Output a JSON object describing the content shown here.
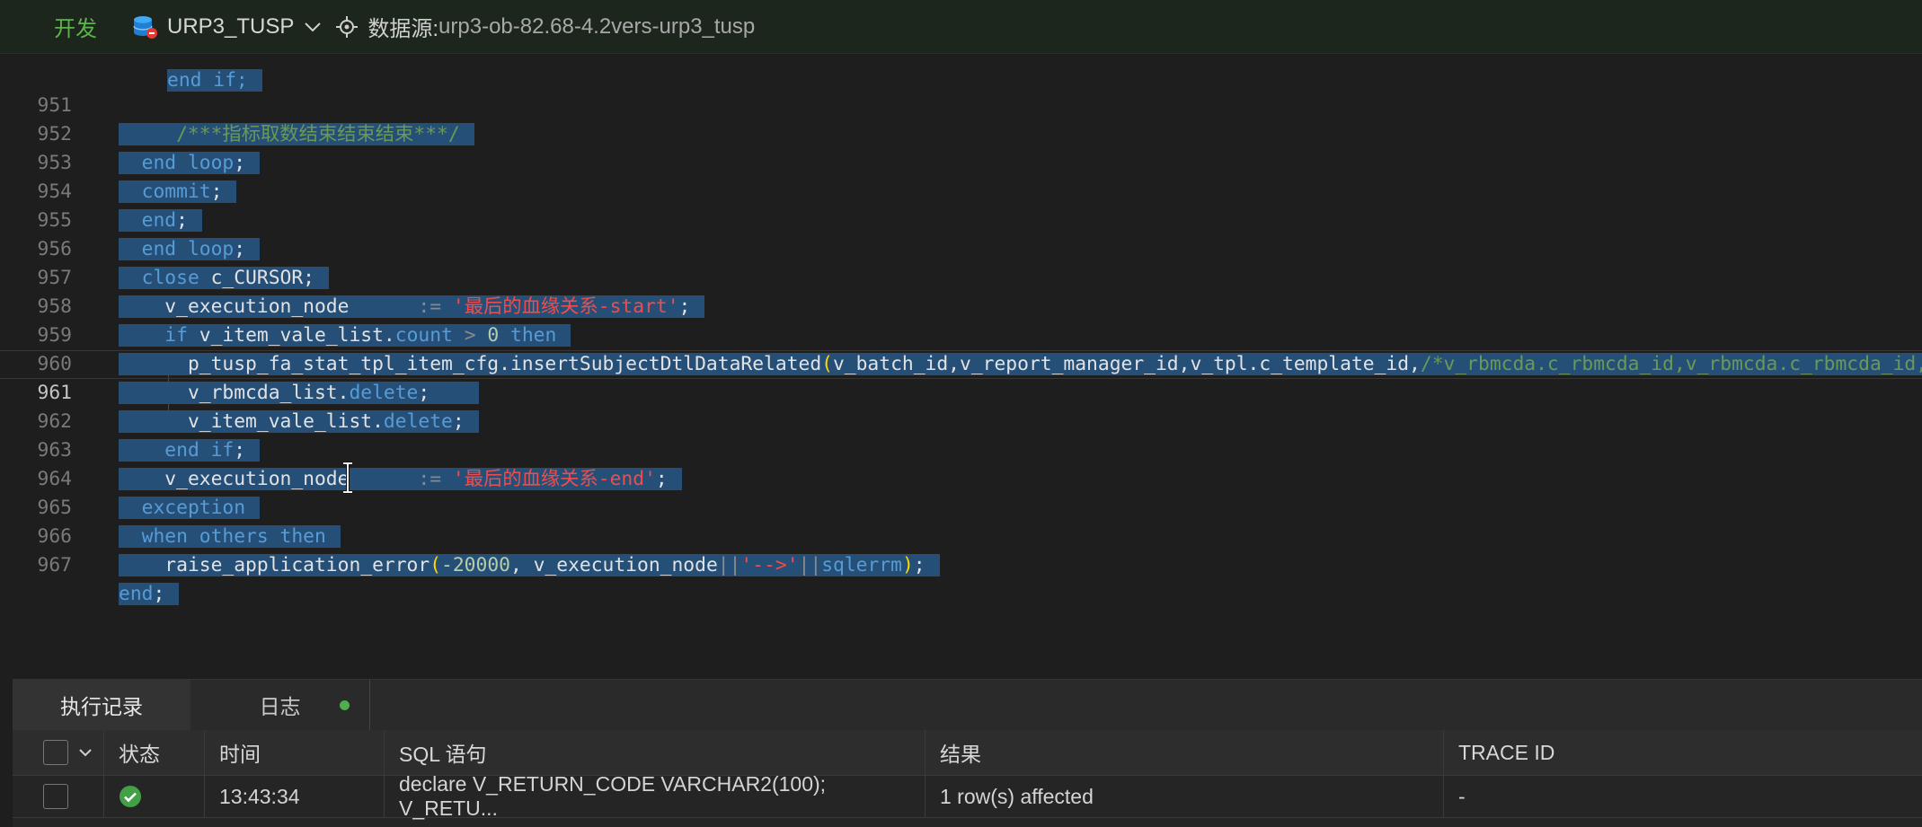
{
  "toolbar": {
    "env_label": "开发",
    "db_name": "URP3_TUSP",
    "datasource_label": "数据源:",
    "datasource_value": "urp3-ob-82.68-4.2vers-urp3_tusp"
  },
  "editor": {
    "lines": [
      {
        "no": "951"
      },
      {
        "no": "952"
      },
      {
        "no": "953"
      },
      {
        "no": "954"
      },
      {
        "no": "955"
      },
      {
        "no": "956"
      },
      {
        "no": "957"
      },
      {
        "no": "958"
      },
      {
        "no": "959"
      },
      {
        "no": "960"
      },
      {
        "no": "961"
      },
      {
        "no": "962"
      },
      {
        "no": "963"
      },
      {
        "no": "964"
      },
      {
        "no": "965"
      },
      {
        "no": "966"
      },
      {
        "no": "967"
      }
    ],
    "code": {
      "l950": "end if;",
      "l951": "/***指标取数结束结束结束***/",
      "l952_a": "end",
      "l952_b": "loop",
      "l952_c": ";",
      "l953_a": "commit",
      "l953_b": ";",
      "l954_a": "end",
      "l954_b": ";",
      "l955_a": "end",
      "l955_b": "loop",
      "l955_c": ";",
      "l956_a": "close",
      "l956_b": "c_CURSOR;",
      "l957_a": "v_execution_node",
      "l957_b": ":=",
      "l957_c": "'最后的血缘关系-start'",
      "l957_d": ";",
      "l958_a": "if",
      "l958_b": "v_item_vale_list.",
      "l958_c": "count",
      "l958_d": ">",
      "l958_e": "0",
      "l958_f": "then",
      "l959_a": "p_tusp_fa_stat_tpl_item_cfg.insertSubjectDtlDataRelated",
      "l959_b": "(",
      "l959_c": "v_batch_id,v_report_manager_id,v_tpl.c_template_id,",
      "l959_d": "/*v_rbmcda.c_rbmcda_id,v_rbmcda.c_rbmcda_id,v_rbmcda.c_rbmcda",
      "l960_a": "v_rbmcda_list.",
      "l960_b": "delete",
      "l960_c": ";",
      "l961_a": "v_item_vale_list.",
      "l961_b": "delete",
      "l961_c": ";",
      "l962_a": "end if",
      "l962_b": ";",
      "l963_a": "v_execution_node",
      "l963_b": ":=",
      "l963_c": "'最后的血缘关系-end'",
      "l963_d": ";",
      "l964_a": "exception",
      "l965_a": "when others then",
      "l966_a": "raise_application_error",
      "l966_b": "(",
      "l966_c": "-20000",
      "l966_d": ", v_execution_node",
      "l966_e": "||",
      "l966_f": "'-->'",
      "l966_g": "||",
      "l966_h": "sqlerrm",
      "l966_i": ")",
      "l966_j": ";",
      "l967_a": "end",
      "l967_b": ";"
    }
  },
  "panel": {
    "tabs": [
      {
        "label": "执行记录"
      },
      {
        "label": "日志"
      }
    ],
    "columns": {
      "status": "状态",
      "time": "时间",
      "sql": "SQL 语句",
      "result": "结果",
      "trace": "TRACE ID"
    },
    "rows": [
      {
        "status_icon": "success-check-icon",
        "time": "13:43:34",
        "sql": "declare V_RETURN_CODE VARCHAR2(100); V_RETU...",
        "result": "1 row(s) affected",
        "trace": "-"
      }
    ]
  },
  "colors": {
    "keyword": "#569cd6",
    "string": "#f14c4c",
    "comment": "#6a9955",
    "selection": "#264f78",
    "env": "#5fb34c",
    "success": "#4caf50"
  }
}
